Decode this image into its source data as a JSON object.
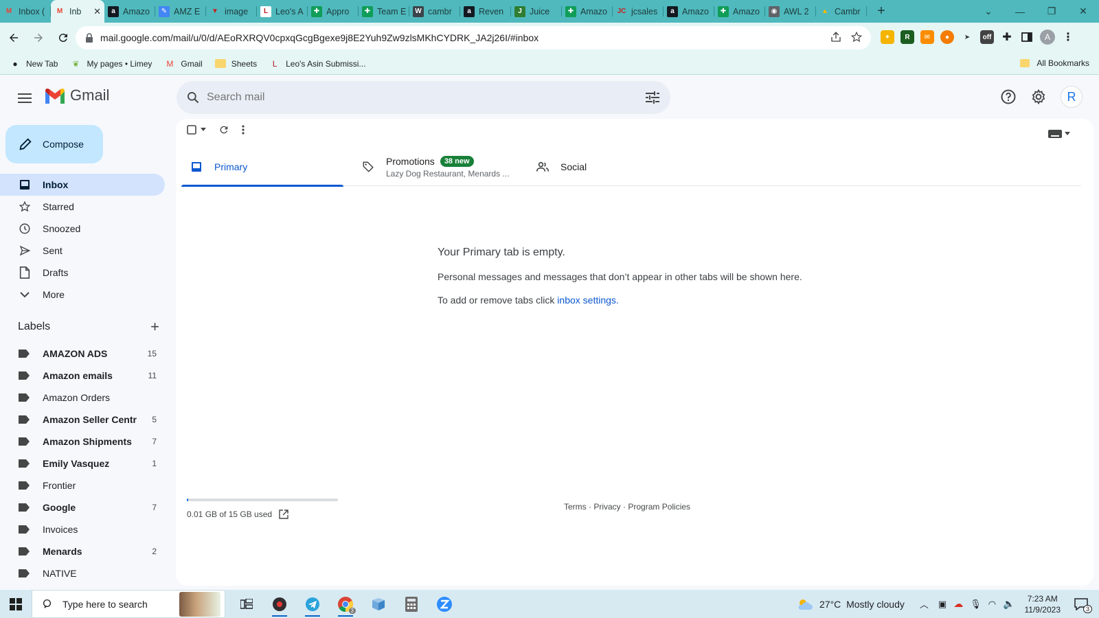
{
  "browser": {
    "tabs": [
      {
        "title": "Inbox (",
        "favicon": "gmail-icon",
        "color": "#ea4335"
      },
      {
        "title": "Inb",
        "favicon": "gmail-icon",
        "color": "#ea4335",
        "active": true
      },
      {
        "title": "Amazo",
        "favicon": "amazon-icon",
        "color": "#131921"
      },
      {
        "title": "AMZ E",
        "favicon": "pencil-icon",
        "color": "#4285f4"
      },
      {
        "title": "image",
        "favicon": "flag-icon",
        "color": "#c5221f"
      },
      {
        "title": "Leo's A",
        "favicon": "leo-icon",
        "color": "#ffffff"
      },
      {
        "title": "Appro",
        "favicon": "sheets-icon",
        "color": "#0f9d58"
      },
      {
        "title": "Team E",
        "favicon": "sheets-icon",
        "color": "#0f9d58"
      },
      {
        "title": "cambr",
        "favicon": "wordpress-icon",
        "color": "#3c434a"
      },
      {
        "title": "Reven",
        "favicon": "amazon-icon",
        "color": "#131921"
      },
      {
        "title": "Juice",
        "favicon": "juice-icon",
        "color": "#2e7d32"
      },
      {
        "title": "Amazo",
        "favicon": "sheets-icon",
        "color": "#0f9d58"
      },
      {
        "title": "jcsales",
        "favicon": "jc-icon",
        "color": "#c5221f"
      },
      {
        "title": "Amazo",
        "favicon": "amazon-icon",
        "color": "#131921"
      },
      {
        "title": "Amazo",
        "favicon": "sheets-icon",
        "color": "#0f9d58"
      },
      {
        "title": "AWL 2",
        "favicon": "globe-icon",
        "color": "#5f6368"
      },
      {
        "title": "Cambr",
        "favicon": "drive-icon",
        "color": "#fbbc04"
      }
    ],
    "url": "mail.google.com/mail/u/0/d/AEoRXRQV0cpxqGcgBgexe9j8E2Yuh9Zw9zlsMKhCYDRK_JA2j26I/#inbox",
    "profile_initial": "A",
    "bookmarks": [
      {
        "label": "New Tab",
        "icon": "github-icon"
      },
      {
        "label": "My pages • Limey",
        "icon": "limey-icon"
      },
      {
        "label": "Gmail",
        "icon": "gmail-icon"
      },
      {
        "label": "Sheets",
        "icon": "folder-icon"
      },
      {
        "label": "Leo's Asin Submissi...",
        "icon": "leo-icon"
      }
    ],
    "all_bookmarks": "All Bookmarks"
  },
  "gmail": {
    "brand": "Gmail",
    "search_placeholder": "Search mail",
    "avatar_initial": "R",
    "compose": "Compose",
    "nav": [
      {
        "label": "Inbox",
        "icon": "inbox-icon",
        "active": true
      },
      {
        "label": "Starred",
        "icon": "star-icon"
      },
      {
        "label": "Snoozed",
        "icon": "clock-icon"
      },
      {
        "label": "Sent",
        "icon": "send-icon"
      },
      {
        "label": "Drafts",
        "icon": "draft-icon"
      },
      {
        "label": "More",
        "icon": "chevron-down-icon"
      }
    ],
    "labels_title": "Labels",
    "labels": [
      {
        "name": "AMAZON ADS",
        "count": "15",
        "bold": true
      },
      {
        "name": "Amazon emails",
        "count": "11",
        "bold": true
      },
      {
        "name": "Amazon Orders",
        "count": "",
        "bold": false
      },
      {
        "name": "Amazon Seller Centr",
        "count": "5",
        "bold": true
      },
      {
        "name": "Amazon Shipments",
        "count": "7",
        "bold": true
      },
      {
        "name": "Emily Vasquez",
        "count": "1",
        "bold": true
      },
      {
        "name": "Frontier",
        "count": "",
        "bold": false
      },
      {
        "name": "Google",
        "count": "7",
        "bold": true
      },
      {
        "name": "Invoices",
        "count": "",
        "bold": false
      },
      {
        "name": "Menards",
        "count": "2",
        "bold": true
      },
      {
        "name": "NATIVE",
        "count": "",
        "bold": false
      }
    ],
    "tabs": {
      "primary": "Primary",
      "promotions": "Promotions",
      "promotions_badge": "38 new",
      "promotions_senders": "Lazy Dog Restaurant, Menards ...",
      "social": "Social"
    },
    "empty": {
      "title": "Your Primary tab is empty.",
      "line1": "Personal messages and messages that don’t appear in other tabs will be shown here.",
      "line2_prefix": "To add or remove tabs click",
      "line2_link": "inbox settings",
      "line2_suffix": "."
    },
    "storage": {
      "text": "0.01 GB of 15 GB used",
      "fraction": 0.01
    },
    "footer": {
      "terms": "Terms",
      "privacy": "Privacy",
      "policies": "Program Policies",
      "separator": " · "
    }
  },
  "taskbar": {
    "search_placeholder": "Type here to search",
    "weather": "27°C  Mostly cloudy",
    "time": "7:23 AM",
    "date": "11/9/2023",
    "notification_count": "3",
    "chrome_badge": "3"
  },
  "colors": {
    "accent": "#0b57d0",
    "compose_bg": "#c2e7ff",
    "tab_strip": "#4fb9bd",
    "promo_badge": "#188038"
  }
}
